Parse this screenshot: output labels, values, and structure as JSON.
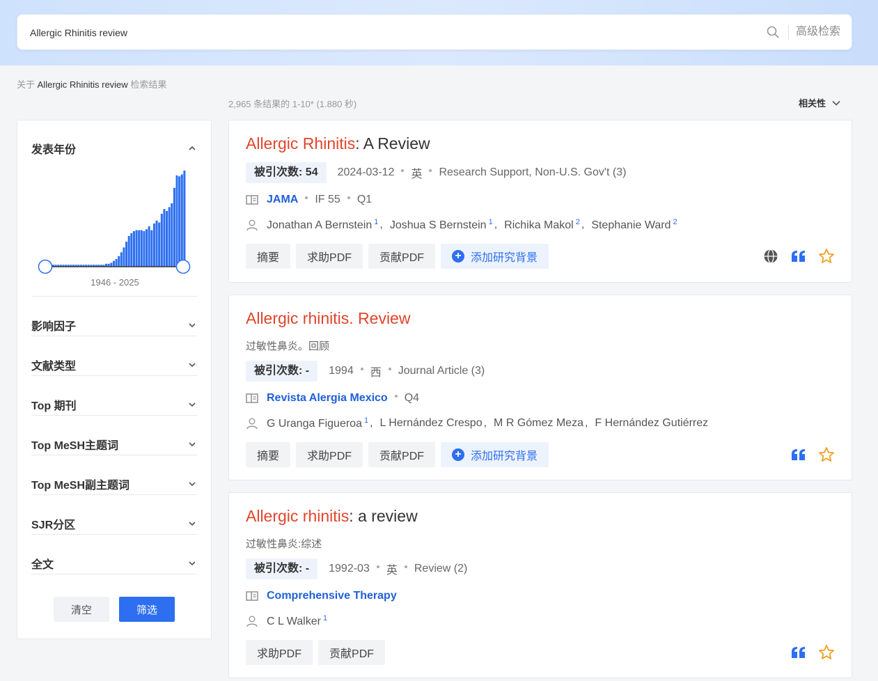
{
  "search": {
    "value": "Allergic Rhinitis review",
    "advanced_label": "高级检索"
  },
  "about": {
    "prefix": "关于",
    "query": "Allergic Rhinitis review",
    "suffix": "检索结果"
  },
  "results_info": "2,965 条结果的 1-10* (1.880 秒)",
  "sort_label": "相关性",
  "sidebar": {
    "year_section": "发表年份",
    "year_range": "1946 - 2025",
    "year_histogram": [
      2,
      2,
      2,
      2,
      2,
      2,
      2,
      2,
      2,
      2,
      2,
      2,
      2,
      2,
      2,
      2,
      2,
      2,
      2,
      2,
      2,
      3,
      3,
      4,
      6,
      8,
      11,
      15,
      20,
      26,
      32,
      35,
      37,
      38,
      38,
      38,
      37,
      39,
      42,
      38,
      45,
      48,
      46,
      55,
      60,
      58,
      62,
      66,
      82,
      95,
      94,
      96,
      100
    ],
    "sections": [
      "影响因子",
      "文献类型",
      "Top 期刊",
      "Top MeSH主题词",
      "Top MeSH副主题词",
      "SJR分区",
      "全文"
    ],
    "clear_label": "清空",
    "filter_label": "筛选"
  },
  "results": [
    {
      "title_hl": "Allergic Rhinitis",
      "title_rest": ": A Review",
      "subtitle": "",
      "cite_label": "被引次数:",
      "cite_value": "54",
      "meta": [
        "2024-03-12",
        "英",
        "Research Support, Non-U.S. Gov't (3)"
      ],
      "journal": "JAMA",
      "journal_meta": [
        "IF 55",
        "Q1"
      ],
      "authors": [
        {
          "name": "Jonathan A Bernstein",
          "sup": "1"
        },
        {
          "name": "Joshua S Bernstein",
          "sup": "1"
        },
        {
          "name": "Richika Makol",
          "sup": "2"
        },
        {
          "name": "Stephanie Ward",
          "sup": "2"
        }
      ],
      "actions": [
        "摘要",
        "求助PDF",
        "贡献PDF"
      ],
      "add_label": "添加研究背景",
      "has_globe": true
    },
    {
      "title_hl": "Allergic rhinitis. Review",
      "title_rest": "",
      "subtitle": "过敏性鼻炎。回顾",
      "cite_label": "被引次数:",
      "cite_value": "-",
      "meta": [
        "1994",
        "西",
        "Journal Article (3)"
      ],
      "journal": "Revista Alergia Mexico",
      "journal_meta": [
        "Q4"
      ],
      "authors": [
        {
          "name": "G Uranga Figueroa",
          "sup": "1"
        },
        {
          "name": "L Hernández Crespo",
          "sup": ""
        },
        {
          "name": "M R Gómez Meza",
          "sup": ""
        },
        {
          "name": "F Hernández Gutiérrez",
          "sup": ""
        }
      ],
      "actions": [
        "摘要",
        "求助PDF",
        "贡献PDF"
      ],
      "add_label": "添加研究背景",
      "has_globe": false
    },
    {
      "title_hl": "Allergic rhinitis",
      "title_rest": ": a review",
      "subtitle": "过敏性鼻炎:综述",
      "cite_label": "被引次数:",
      "cite_value": "-",
      "meta": [
        "1992-03",
        "英",
        "Review (2)"
      ],
      "journal": "Comprehensive Therapy",
      "journal_meta": [],
      "authors": [
        {
          "name": "C L Walker",
          "sup": "1"
        }
      ],
      "actions": [
        "求助PDF",
        "贡献PDF"
      ],
      "add_label": "",
      "has_globe": false
    }
  ],
  "colors": {
    "accent": "#2d6ff0",
    "highlight": "#e0452b",
    "star": "#f0a020"
  }
}
